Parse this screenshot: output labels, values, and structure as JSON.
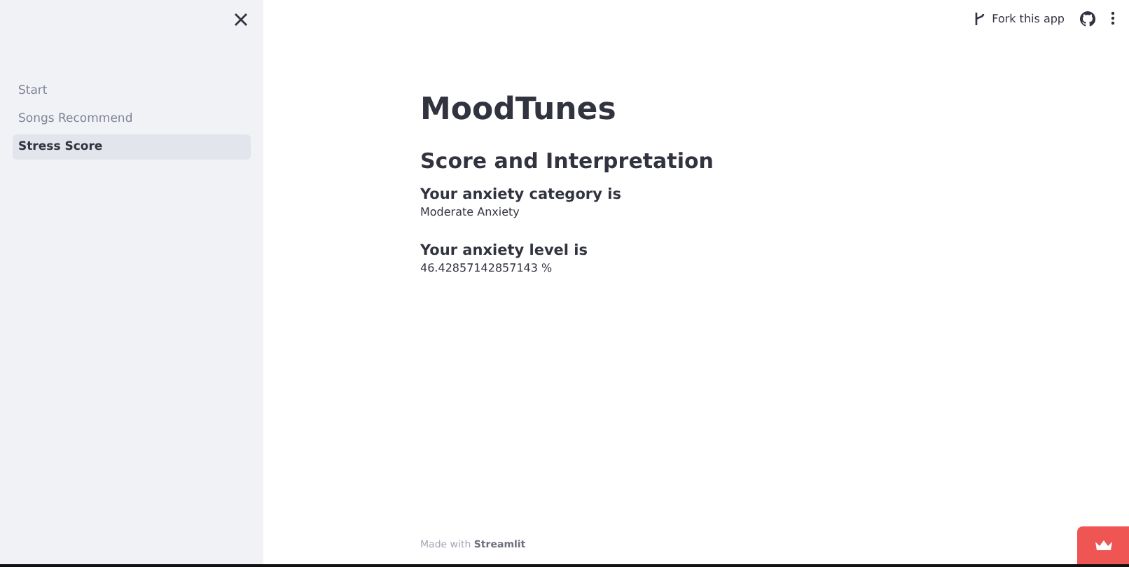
{
  "sidebar": {
    "items": [
      {
        "label": "Start",
        "selected": false
      },
      {
        "label": "Songs Recommend",
        "selected": false
      },
      {
        "label": "Stress Score",
        "selected": true
      }
    ]
  },
  "header": {
    "fork_label": "Fork this app"
  },
  "main": {
    "title": "MoodTunes",
    "subtitle": "Score and Interpretation",
    "results": [
      {
        "heading": "Your anxiety category is",
        "value": "Moderate Anxiety"
      },
      {
        "heading": "Your anxiety level is",
        "value": "46.42857142857143 %"
      }
    ]
  },
  "footer": "Made with **Streamlit**"
}
